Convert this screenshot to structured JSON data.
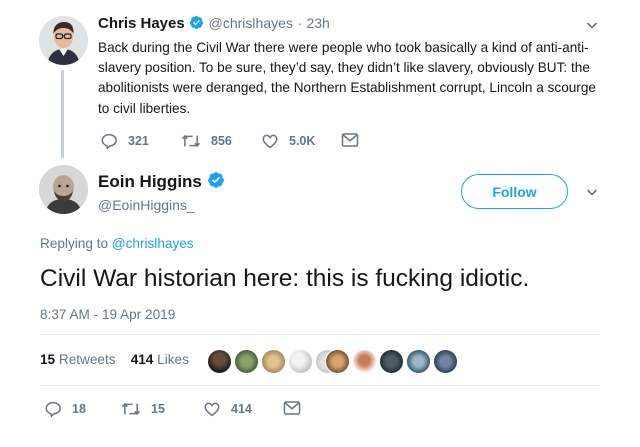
{
  "parent_tweet": {
    "author_name": "Chris Hayes",
    "handle": "@chrislhayes",
    "separator": "·",
    "time": "23h",
    "text": "Back during the Civil War there were people who took basically a kind of anti-anti-slavery position. To be sure, they’d say, they didn’t like slavery, obviously BUT: the abolitionists were deranged, the Northern Establishment corrupt, Lincoln a scourge to civil liberties.",
    "replies": "321",
    "retweets": "856",
    "likes": "5.0K"
  },
  "main_tweet": {
    "author_name": "Eoin Higgins",
    "handle": "@EoinHiggins_",
    "follow_label": "Follow",
    "replying_prefix": "Replying to",
    "replying_handle": "@chrislhayes",
    "text": "Civil War historian here: this is fucking idiotic.",
    "timestamp": "8:37 AM - 19 Apr 2019",
    "retweet_count": "15",
    "retweet_label": "Retweets",
    "like_count": "414",
    "like_label": "Likes",
    "replies": "18",
    "retweets": "15",
    "likes": "414"
  },
  "colors": {
    "accent": "#1da1f2",
    "secondary_text": "#657786",
    "divider": "#e6ecf0"
  },
  "icons": [
    "verified-badge-icon",
    "chevron-down-icon",
    "reply-icon",
    "retweet-icon",
    "like-icon",
    "direct-message-icon"
  ]
}
